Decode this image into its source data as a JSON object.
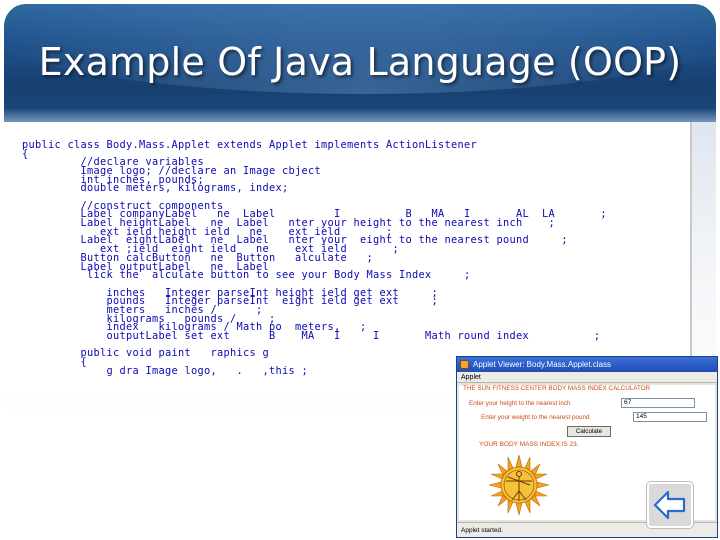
{
  "slide": {
    "title": "Example Of Java Language (OOP)"
  },
  "code_lines": [
    "public class Body.Mass.Applet extends Applet implements ActionListener",
    "{",
    "         //declare variables",
    "         Image logo; //declare an Image cbject",
    "         int inches, pounds;",
    "         double meters, kilograms, index;",
    "",
    "         //construct components",
    "         Label companyLabel   ne  Label         I          B   MA   I       AL  LA       ;",
    "         Label heightLabel   ne  Label   nter your height to the nearest inch    ;",
    "            ext ield height ield   ne    ext ield       ;",
    "         Label  eightLabel   ne  Label   nter your  eight to the nearest pound     ;",
    "            ext ;ield  eight ield   ne    ext ield       ;",
    "         Button calcButton   ne  Button   alculate   ;",
    "         Label outputLabel   ne  Label",
    "          lick the  alculate button to see your Body Mass Index     ;",
    "",
    "             inches   Integer parseInt height ield get ext     ;",
    "             pounds   Integer parseInt  eight ield get ext     ;",
    "             meters   inches /      ;",
    "             kilograms   pounds /     ;",
    "             index   kilograms / Math po  meters,   ;",
    "             outputLabel set ext      B    MA   I     I       Math round index          ;",
    "",
    "         public void paint   raphics g",
    "         {",
    "             g dra Image logo,   .   ,this ;"
  ],
  "applet": {
    "window_title": "Applet Viewer: Body.Mass.Applet.class",
    "menu": "Applet",
    "heading": "THE SUN FITNESS CENTER BODY MASS INDEX CALCULATOR",
    "height_label": "Enter your height to the nearest inch",
    "height_value": "67",
    "weight_label": "Enter your weight to the nearest pound",
    "weight_value": "145",
    "button_label": "Calculate",
    "result": "YOUR BODY MASS INDEX IS 23.",
    "status": "Applet started."
  },
  "icons": {
    "back": "back-arrow-icon",
    "java": "java-cup-icon",
    "logo": "sun-vitruvian-logo"
  },
  "colors": {
    "header_blue": "#1f5089",
    "code_blue": "#0c0ab4",
    "applet_orange": "#d0481a",
    "titlebar_blue": "#1f4db8"
  }
}
